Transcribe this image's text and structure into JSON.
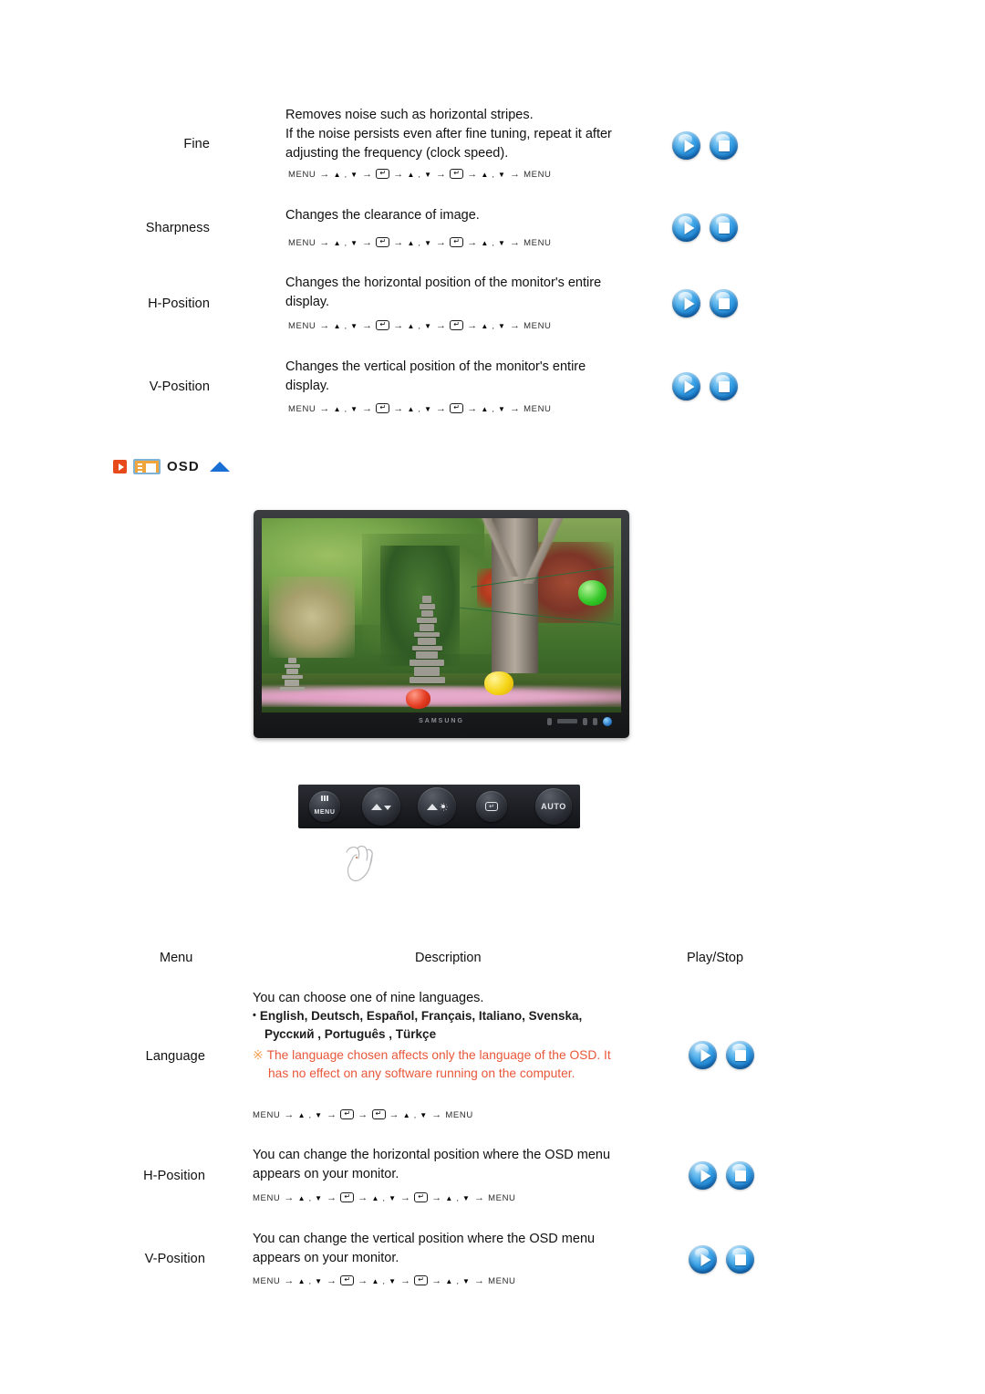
{
  "document": {
    "title": "Samsung Monitor OSD User Manual - Image & OSD Settings"
  },
  "image_section": {
    "rows": [
      {
        "menu": "Fine",
        "description": [
          "Removes noise such as horizontal stripes.",
          "If the noise persists even after fine tuning, repeat it after",
          "adjusting the frequency (clock speed)."
        ],
        "path": [
          "MENU",
          "→",
          "▲ , ▼",
          "→",
          "ENTER",
          "→",
          "▲ , ▼",
          "→",
          "ENTER",
          "→",
          "▲ , ▼",
          "→",
          "MENU"
        ],
        "controls": [
          "play",
          "stop"
        ]
      },
      {
        "menu": "Sharpness",
        "description": [
          "Changes the clearance of image."
        ],
        "path": [
          "MENU",
          "→",
          "▲ , ▼",
          "→",
          "ENTER",
          "→",
          "▲ , ▼",
          "→",
          "ENTER",
          "→",
          "▲ , ▼",
          "→",
          "MENU"
        ],
        "controls": [
          "play",
          "stop"
        ]
      },
      {
        "menu": "H-Position",
        "description": [
          "Changes the horizontal position of the monitor's entire",
          "display."
        ],
        "path": [
          "MENU",
          "→",
          "▲ , ▼",
          "→",
          "ENTER",
          "→",
          "▲ , ▼",
          "→",
          "ENTER",
          "→",
          "▲ , ▼",
          "→",
          "MENU"
        ],
        "controls": [
          "play",
          "stop"
        ]
      },
      {
        "menu": "V-Position",
        "description": [
          "Changes the vertical position of the monitor's entire",
          "display."
        ],
        "path": [
          "MENU",
          "→",
          "▲ , ▼",
          "→",
          "ENTER",
          "→",
          "▲ , ▼",
          "→",
          "ENTER",
          "→",
          "▲ , ▼",
          "→",
          "MENU"
        ],
        "controls": [
          "play",
          "stop"
        ]
      }
    ]
  },
  "osd_heading": {
    "label": "OSD",
    "icons": [
      "red-play-icon",
      "screen-panel-icon",
      "blue-up-triangle-icon"
    ],
    "accent_red": "#e8491b",
    "accent_orange": "#f0a53c",
    "accent_blue": "#1a6fd4"
  },
  "monitor": {
    "brand": "SAMSUNG",
    "alt": "Samsung LCD monitor showing a photo of a stone pagoda in a garden with paper lanterns"
  },
  "button_panel": {
    "buttons": [
      {
        "name": "menu-button",
        "label": "MENU",
        "glyph": "menu-bars-icon"
      },
      {
        "name": "down-adjust-button",
        "label": "",
        "glyph": "mountain-down-icon"
      },
      {
        "name": "brightness-button",
        "label": "",
        "glyph": "mountain-sun-icon"
      },
      {
        "name": "enter-button",
        "label": "",
        "glyph": "enter-key-icon"
      },
      {
        "name": "auto-button",
        "label": "AUTO",
        "glyph": "text-only"
      }
    ],
    "cursor": "hand-pointer-icon"
  },
  "osd_table": {
    "headers": {
      "menu": "Menu",
      "description": "Description",
      "play_stop": "Play/Stop"
    },
    "rows": [
      {
        "menu": "Language",
        "description": [
          "You can choose one of nine languages."
        ],
        "languages_line1": "English, Deutsch, Español, Français,  Italiano, Svenska,",
        "languages_line2": "Русский , Português , Türkçe",
        "languages": [
          "English",
          "Deutsch",
          "Español",
          "Français",
          "Italiano",
          "Svenska",
          "Русский",
          "Português",
          "Türkçe"
        ],
        "note_mark": "※",
        "note": [
          "The language chosen affects only the language of the OSD. It",
          "has no effect on any software running on the computer."
        ],
        "path": [
          "MENU",
          "→",
          "▲ , ▼",
          "→",
          "ENTER",
          "→",
          "ENTER",
          "→",
          "▲ , ▼",
          "→",
          "MENU"
        ],
        "controls": [
          "play",
          "stop"
        ]
      },
      {
        "menu": "H-Position",
        "description": [
          "You can change the horizontal position where the OSD menu",
          "appears on your monitor."
        ],
        "path": [
          "MENU",
          "→",
          "▲ , ▼",
          "→",
          "ENTER",
          "→",
          "▲ , ▼",
          "→",
          "ENTER",
          "→",
          "▲ , ▼",
          "→",
          "MENU"
        ],
        "controls": [
          "play",
          "stop"
        ]
      },
      {
        "menu": "V-Position",
        "description": [
          "You can change the vertical position where the OSD menu",
          "appears on your monitor."
        ],
        "path": [
          "MENU",
          "→",
          "▲ , ▼",
          "→",
          "ENTER",
          "→",
          "▲ , ▼",
          "→",
          "ENTER",
          "→",
          "▲ , ▼",
          "→",
          "MENU"
        ],
        "controls": [
          "play",
          "stop"
        ]
      }
    ]
  }
}
